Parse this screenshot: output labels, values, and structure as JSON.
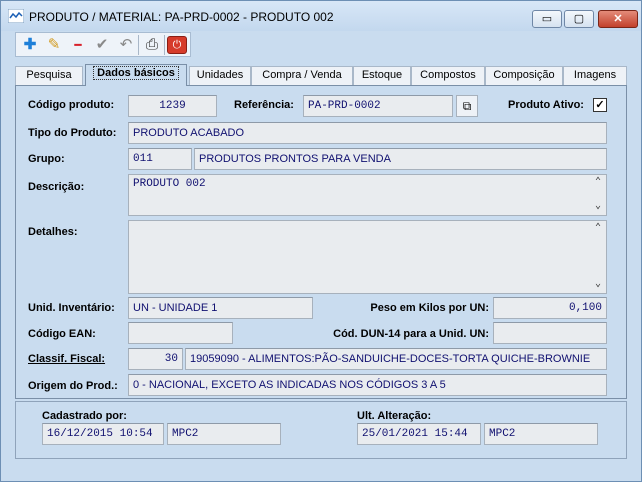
{
  "window": {
    "title": "PRODUTO / MATERIAL: PA-PRD-0002 - PRODUTO 002",
    "minimize_glyph": "▭",
    "maximize_glyph": "▢",
    "close_glyph": "✕"
  },
  "toolbar": {
    "icons": [
      "plus-icon",
      "pencil-icon",
      "minus-icon",
      "checkmark-icon",
      "undo-icon",
      "print-icon",
      "power-icon"
    ],
    "glyphs": {
      "add": "✚",
      "edit": "✎",
      "delete": "━",
      "confirm": "✔",
      "undo": "↶",
      "print": "⎙",
      "exit": "⏻"
    }
  },
  "tabs": [
    {
      "label": "Pesquisa"
    },
    {
      "label": "Dados básicos"
    },
    {
      "label": "Unidades"
    },
    {
      "label": "Compra / Venda"
    },
    {
      "label": "Estoque"
    },
    {
      "label": "Compostos"
    },
    {
      "label": "Composição"
    },
    {
      "label": "Imagens"
    }
  ],
  "form": {
    "codigo_label": "Código produto:",
    "codigo_value": "1239",
    "referencia_label": "Referência:",
    "referencia_value": "PA-PRD-0002",
    "ativo_label": "Produto Ativo:",
    "ativo_checked": "✓",
    "tipo_label": "Tipo do Produto:",
    "tipo_value": "PRODUTO ACABADO",
    "grupo_label": "Grupo:",
    "grupo_code": "011",
    "grupo_desc": "PRODUTOS PRONTOS PARA VENDA",
    "descricao_label": "Descrição:",
    "descricao_value": "PRODUTO 002",
    "detalhes_label": "Detalhes:",
    "detalhes_value": "",
    "unid_label": "Unid. Inventário:",
    "unid_value": "UN - UNIDADE 1",
    "peso_label": "Peso em Kilos por UN:",
    "peso_value": "0,100",
    "ean_label": "Código EAN:",
    "ean_value": "",
    "dun_label": "Cód. DUN-14 para a Unid. UN:",
    "dun_value": "",
    "classif_label": "Classif. Fiscal:",
    "classif_code": "30",
    "classif_desc": "19059090 - ALIMENTOS:PÃO-SANDUICHE-DOCES-TORTA QUICHE-BROWNIE",
    "origem_label": "Origem do Prod.:",
    "origem_value": "0 - NACIONAL, EXCETO AS INDICADAS NOS CÓDIGOS 3 A 5",
    "scroll_up": "⌃",
    "scroll_down": "⌄",
    "copy_glyph": "⧉"
  },
  "audit": {
    "cadastrado_label": "Cadastrado por:",
    "cadastrado_date": "16/12/2015 10:54",
    "cadastrado_user": "MPC2",
    "alteracao_label": "Ult. Alteração:",
    "alteracao_date": "25/01/2021 15:44",
    "alteracao_user": "MPC2"
  },
  "colors": {
    "window_bg": "#c9dcef",
    "field_bg": "#e9ecef",
    "value_text": "#101070"
  }
}
